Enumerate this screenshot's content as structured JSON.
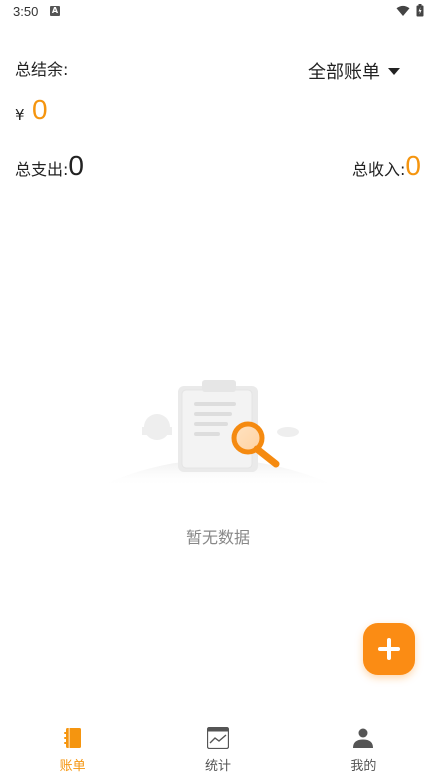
{
  "status_bar": {
    "time": "3:50",
    "notification_glyph": "A"
  },
  "header": {
    "balance_label": "总结余:",
    "filter_label": "全部账单",
    "currency_symbol": "¥",
    "balance_value": "0"
  },
  "stats": {
    "expense_label": "总支出:",
    "expense_value": "0",
    "income_label": "总收入:",
    "income_value": "0"
  },
  "empty_state": {
    "message": "暂无数据",
    "icon": "empty-search-illustration"
  },
  "fab": {
    "icon": "plus-icon"
  },
  "bottom_nav": {
    "items": [
      {
        "label": "账单",
        "icon": "ledger-icon",
        "active": true
      },
      {
        "label": "统计",
        "icon": "chart-icon",
        "active": false
      },
      {
        "label": "我的",
        "icon": "person-icon",
        "active": false
      }
    ]
  },
  "colors": {
    "accent": "#f5950f",
    "fab": "#fb8c14",
    "text": "#222222",
    "muted": "#888888"
  }
}
